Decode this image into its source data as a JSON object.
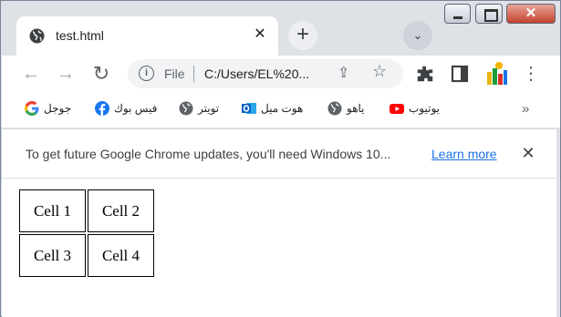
{
  "window": {
    "close_glyph": "✕"
  },
  "tab": {
    "title": "test.html",
    "close_glyph": "✕"
  },
  "tabstrip": {
    "new_tab_glyph": "+",
    "tab_search_glyph": "⌄"
  },
  "toolbar": {
    "back_glyph": "←",
    "forward_glyph": "→",
    "reload_glyph": "↻",
    "menu_glyph": "⋮"
  },
  "omnibox": {
    "info_glyph": "i",
    "scheme_label": "File",
    "url": "C:/Users/EL%20...",
    "share_glyph": "⇪",
    "star_glyph": "☆"
  },
  "bookmarks": {
    "items": [
      {
        "label": "يوتيوب",
        "icon": "youtube-icon",
        "color": "#ff0000"
      },
      {
        "label": "ياهو",
        "icon": "globe-icon",
        "color": "#5f6368"
      },
      {
        "label": "هوت ميل",
        "icon": "outlook-icon",
        "color": "#0a64c7"
      },
      {
        "label": "تويتر",
        "icon": "globe-icon",
        "color": "#5f6368"
      },
      {
        "label": "فيس بوك",
        "icon": "facebook-icon",
        "color": "#1877f2"
      },
      {
        "label": "جوجل",
        "icon": "google-icon",
        "color": "#4285f4"
      }
    ],
    "more_glyph": "»"
  },
  "infobar": {
    "message": "To get future Google Chrome updates, you'll need Windows 10...",
    "link_text": "Learn more",
    "close_glyph": "✕"
  },
  "page": {
    "cells": [
      [
        "Cell 1",
        "Cell 2"
      ],
      [
        "Cell 3",
        "Cell 4"
      ]
    ]
  }
}
